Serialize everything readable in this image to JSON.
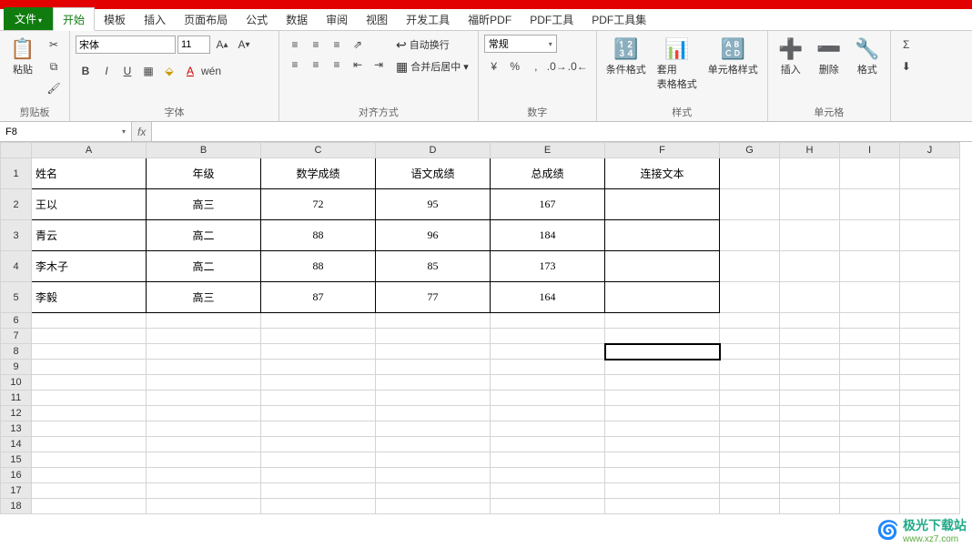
{
  "tabs": {
    "file": "文件",
    "list": [
      "开始",
      "模板",
      "插入",
      "页面布局",
      "公式",
      "数据",
      "审阅",
      "视图",
      "开发工具",
      "福昕PDF",
      "PDF工具",
      "PDF工具集"
    ],
    "active": "开始"
  },
  "ribbon": {
    "clipboard": {
      "paste": "粘贴",
      "label": "剪贴板"
    },
    "font": {
      "name": "宋体",
      "size": "11",
      "label": "字体"
    },
    "align": {
      "wrap": "自动换行",
      "merge": "合并后居中",
      "label": "对齐方式"
    },
    "number": {
      "format": "常规",
      "label": "数字"
    },
    "styles": {
      "cond": "条件格式",
      "table": "套用\n表格格式",
      "cell": "单元格样式",
      "label": "样式"
    },
    "cells": {
      "insert": "插入",
      "delete": "删除",
      "format": "格式",
      "label": "单元格"
    }
  },
  "namebox": "F8",
  "fx": "fx",
  "columns": [
    "A",
    "B",
    "C",
    "D",
    "E",
    "F",
    "G",
    "H",
    "I",
    "J"
  ],
  "rows": [
    "1",
    "2",
    "3",
    "4",
    "5",
    "6",
    "7",
    "8",
    "9",
    "10",
    "11",
    "12",
    "13",
    "14",
    "15",
    "16",
    "17",
    "18"
  ],
  "headers": [
    "姓名",
    "年级",
    "数学成绩",
    "语文成绩",
    "总成绩",
    "连接文本"
  ],
  "data": [
    {
      "name": "王以",
      "grade": "高三",
      "math": "72",
      "chinese": "95",
      "total": "167"
    },
    {
      "name": "青云",
      "grade": "高二",
      "math": "88",
      "chinese": "96",
      "total": "184"
    },
    {
      "name": "李木子",
      "grade": "高二",
      "math": "88",
      "chinese": "85",
      "total": "173"
    },
    {
      "name": "李毅",
      "grade": "高三",
      "math": "87",
      "chinese": "77",
      "total": "164"
    }
  ],
  "selected_cell": "F8",
  "watermark": {
    "text": "极光下载站",
    "url": "www.xz7.com"
  }
}
